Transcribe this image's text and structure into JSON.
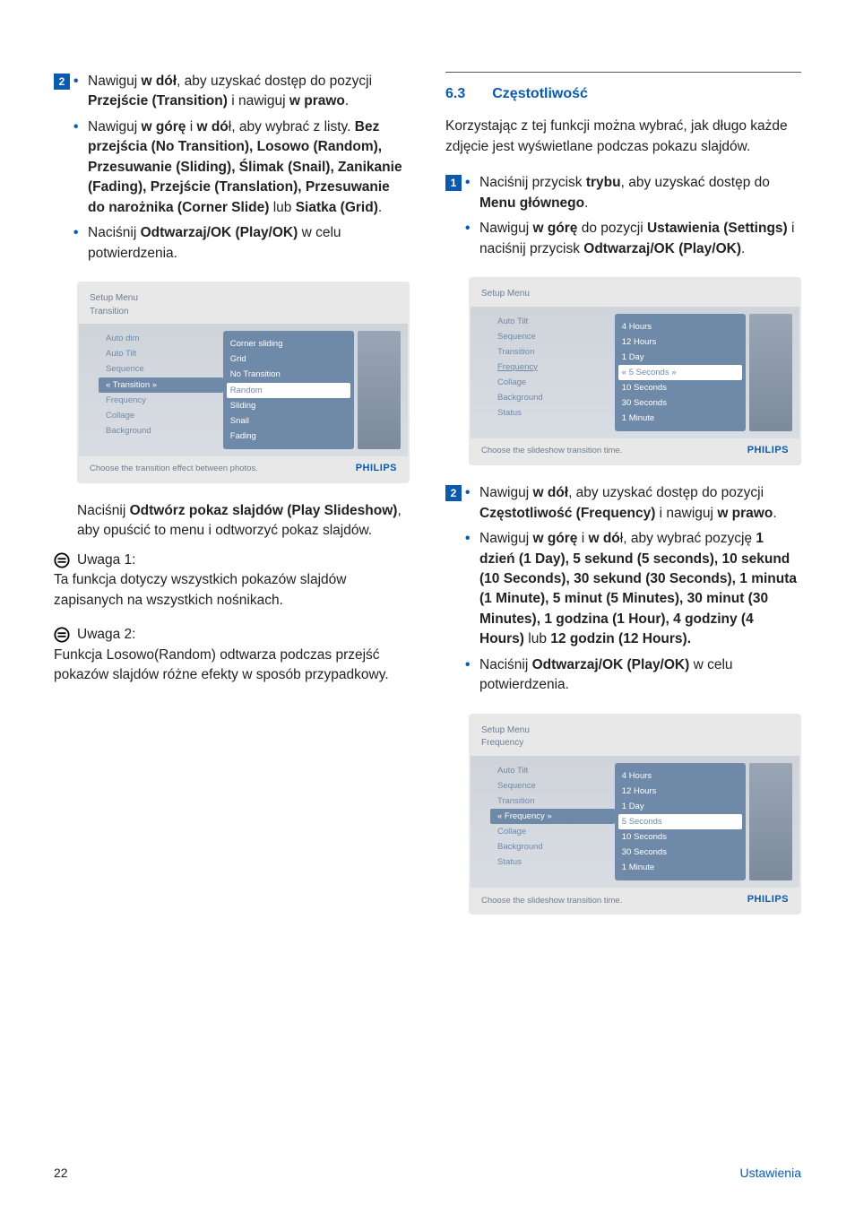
{
  "left": {
    "step2": {
      "marker": "2",
      "b1_pre": "Nawiguj ",
      "b1_bold1": "w dół",
      "b1_mid1": ", aby uzyskać dostęp do pozycji ",
      "b1_bold2": "Przejście (Transition)",
      "b1_mid2": " i nawiguj ",
      "b1_bold3": "w prawo",
      "b1_end": ".",
      "b2_pre": "Nawiguj ",
      "b2_bold1": "w górę",
      "b2_mid1": " i ",
      "b2_bold2": "w dó",
      "b2_mid2": "ł, aby wybrać z listy. ",
      "b2_bold3": "Bez przejścia (No Transition), Losowo (Random), Przesuwanie (Sliding), Ślimak (Snail), Zanikanie (Fading), Przejście (Translation), Przesuwanie do narożnika (Corner Slide)",
      "b2_mid3": " lub ",
      "b2_bold4": "Siatka (Grid)",
      "b2_end": ".",
      "b3_pre": "Naciśnij ",
      "b3_bold1": "Odtwarzaj/OK (Play/OK)",
      "b3_end": " w celu potwierdzenia."
    },
    "ui1": {
      "header1": "Setup Menu",
      "header2": "Transition",
      "left_items": [
        "Auto dim",
        "Auto Tilt",
        "Sequence",
        "« Transition »",
        "Frequency",
        "Collage",
        "Background"
      ],
      "left_selected_index": 3,
      "right_items": [
        "Corner sliding",
        "Grid",
        "No Transition",
        "Random",
        "Sliding",
        "Snail",
        "Fading"
      ],
      "right_selected_index": 3,
      "hint": "Choose the transition effect between photos.",
      "brand": "PHILIPS"
    },
    "post_ui": {
      "pre": "Naciśnij ",
      "bold": "Odtwórz pokaz slajdów (Play Slideshow)",
      "end": ", aby opuścić to menu i odtworzyć pokaz slajdów."
    },
    "note1": {
      "title": "Uwaga 1:",
      "body": "Ta funkcja dotyczy wszystkich pokazów slajdów zapisanych na wszystkich nośnikach."
    },
    "note2": {
      "title": "Uwaga 2:",
      "body": "Funkcja Losowo(Random) odtwarza podczas przejść pokazów slajdów różne efekty w sposób przypadkowy."
    }
  },
  "right": {
    "section_num": "6.3",
    "section_title": "Częstotliwość",
    "intro": "Korzystając z tej funkcji można wybrać, jak długo każde zdjęcie jest  wyświetlane podczas pokazu slajdów.",
    "step1": {
      "marker": "1",
      "b1_pre": "Naciśnij przycisk ",
      "b1_bold1": "trybu",
      "b1_mid1": ", aby uzyskać dostęp do ",
      "b1_bold2": "Menu głównego",
      "b1_end": ".",
      "b2_pre": "Nawiguj ",
      "b2_bold1": "w górę",
      "b2_mid1": " do pozycji ",
      "b2_bold2": "Ustawienia (Settings)",
      "b2_mid2": " i naciśnij przycisk ",
      "b2_bold3": "Odtwarzaj/OK (Play/OK)",
      "b2_end": "."
    },
    "ui1": {
      "header1": "Setup Menu",
      "left_items": [
        "Auto Tilt",
        "Sequence",
        "Transition",
        "Frequency",
        "Collage",
        "Background",
        "Status"
      ],
      "left_selected_index": 3,
      "left_selected_style": "plain",
      "right_items": [
        "4 Hours",
        "12 Hours",
        "1 Day",
        "« 5 Seconds »",
        "10 Seconds",
        "30 Seconds",
        "1 Minute"
      ],
      "right_selected_index": 3,
      "hint": "Choose the slideshow transition time.",
      "brand": "PHILIPS"
    },
    "step2": {
      "marker": "2",
      "b1_pre": "Nawiguj ",
      "b1_bold1": "w dół",
      "b1_mid1": ", aby uzyskać dostęp do pozycji ",
      "b1_bold2": "Częstotliwość (Frequency)",
      "b1_mid2": " i nawiguj ",
      "b1_bold3": "w prawo",
      "b1_end": ".",
      "b2_pre": "Nawiguj ",
      "b2_bold1": "w górę",
      "b2_mid1": " i ",
      "b2_bold2": "w dó",
      "b2_mid2": "ł, aby wybrać pozycję ",
      "b2_bold3": "1 dzień (1 Day), 5 sekund (5 seconds), 10 sekund (10 Seconds), 30 sekund (30 Seconds), 1 minuta (1 Minute), 5 minut (5 Minutes), 30 minut (30 Minutes), 1 godzina (1 Hour), 4 godziny (4 Hours)",
      "b2_mid3": " lub ",
      "b2_bold4": "12 godzin (12 Hours).",
      "b3_pre": "Naciśnij ",
      "b3_bold1": "Odtwarzaj/OK (Play/OK)",
      "b3_end": " w celu potwierdzenia."
    },
    "ui2": {
      "header1": "Setup Menu",
      "header2": "Frequency",
      "left_items": [
        "Auto Tilt",
        "Sequence",
        "Transition",
        "« Frequency »",
        "Collage",
        "Background",
        "Status"
      ],
      "left_selected_index": 3,
      "right_items": [
        "4 Hours",
        "12 Hours",
        "1 Day",
        "5 Seconds",
        "10 Seconds",
        "30 Seconds",
        "1 Minute"
      ],
      "right_selected_index": 3,
      "hint": "Choose the slideshow transition time.",
      "brand": "PHILIPS"
    }
  },
  "footer": {
    "page": "22",
    "section": "Ustawienia"
  }
}
